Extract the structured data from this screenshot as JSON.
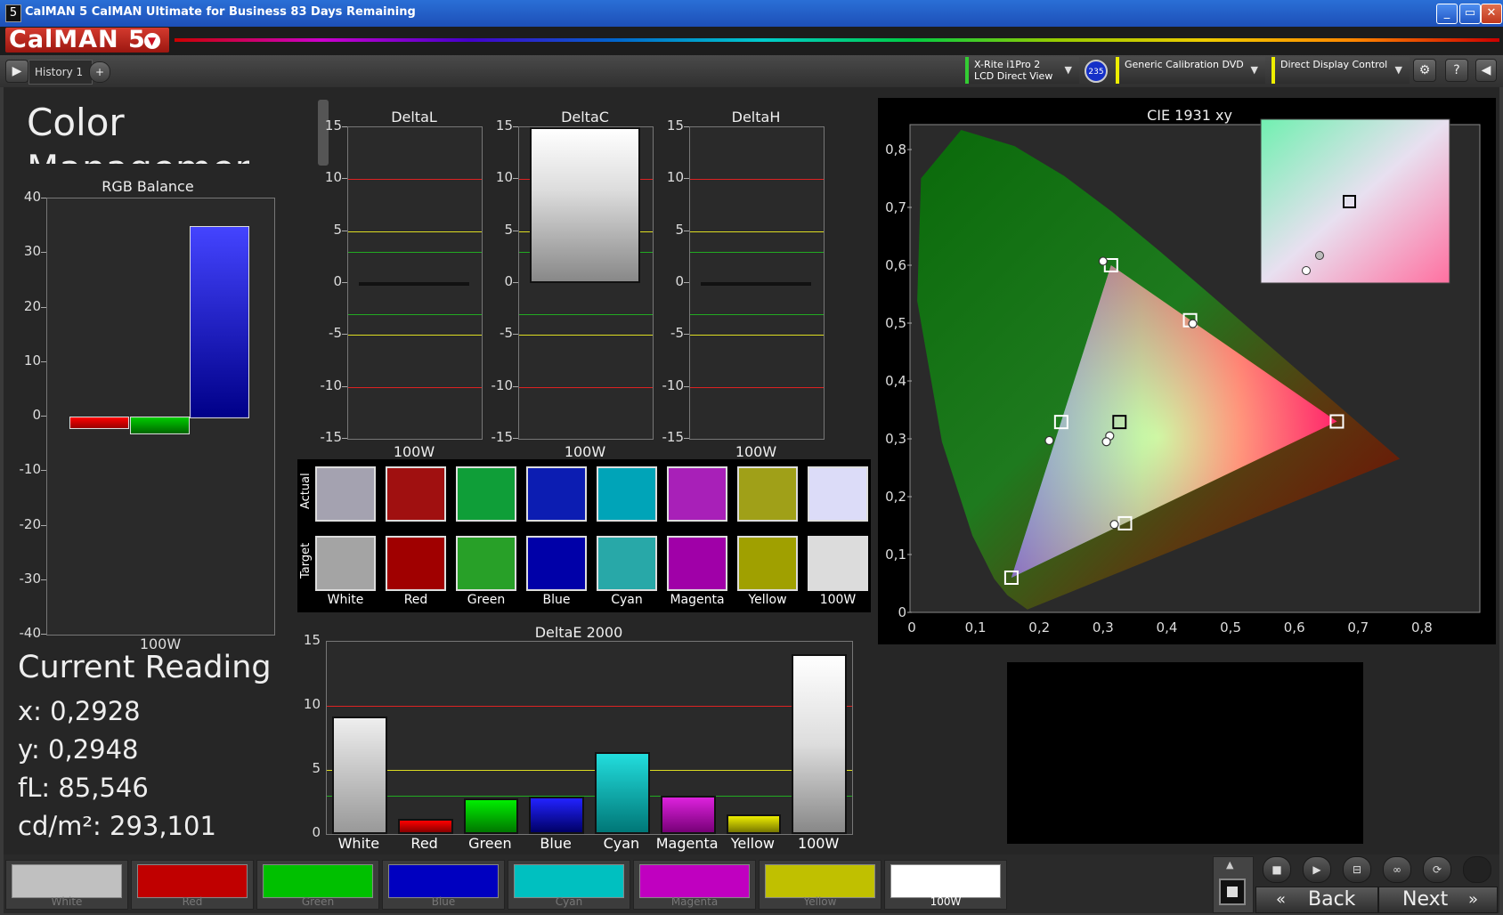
{
  "window": {
    "title": "CalMAN 5 CalMAN Ultimate for Business 83 Days Remaining",
    "min": "_",
    "max": "▭",
    "close": "✕"
  },
  "logo": {
    "text": "CalMAN 5"
  },
  "toolbar": {
    "play": "▶",
    "history_tab": "History 1",
    "add_tab": "+",
    "meter": {
      "line1": "X-Rite i1Pro 2",
      "line2": "LCD Direct View",
      "badge": "235"
    },
    "source": "Generic Calibration DVD",
    "display": "Direct Display Control",
    "settings": "⚙",
    "help": "?",
    "collapse": "◀",
    "dropdown": "▼"
  },
  "page": {
    "title": "Color Management"
  },
  "rgb_balance": {
    "title": "RGB Balance",
    "ticks": [
      "40",
      "30",
      "20",
      "10",
      "0",
      "-10",
      "-20",
      "-30",
      "-40"
    ],
    "xlabel": "100W"
  },
  "delta_charts": [
    {
      "title": "DeltaL",
      "xlabel": "100W"
    },
    {
      "title": "DeltaC",
      "xlabel": "100W"
    },
    {
      "title": "DeltaH",
      "xlabel": "100W"
    }
  ],
  "delta_ticks": [
    "15",
    "10",
    "5",
    "0",
    "-5",
    "-10",
    "-15"
  ],
  "swatches": {
    "actual_label": "Actual",
    "target_label": "Target",
    "names": [
      "White",
      "Red",
      "Green",
      "Blue",
      "Cyan",
      "Magenta",
      "Yellow",
      "100W"
    ],
    "actual_colors": [
      "#a4a2b0",
      "#a01010",
      "#0f9e38",
      "#0c1db2",
      "#00a4b8",
      "#a820b8",
      "#a0a018",
      "#dcdcf8"
    ],
    "target_colors": [
      "#a4a4a4",
      "#a00000",
      "#28a028",
      "#0000a8",
      "#28a8a8",
      "#a000a8",
      "#a0a000",
      "#dcdcdc"
    ]
  },
  "deltae": {
    "title": "DeltaE 2000",
    "ticks": [
      "15",
      "10",
      "5",
      "0"
    ]
  },
  "cie": {
    "title": "CIE 1931 xy",
    "yticks": [
      "0,8",
      "0,7",
      "0,6",
      "0,5",
      "0,4",
      "0,3",
      "0,2",
      "0,1",
      "0"
    ],
    "xticks": [
      "0",
      "0,1",
      "0,2",
      "0,3",
      "0,4",
      "0,5",
      "0,6",
      "0,7",
      "0,8"
    ]
  },
  "current_reading": {
    "title": "Current Reading",
    "x": "x: 0,2928",
    "y": "y: 0,2948",
    "fl": "fL: 85,546",
    "cdm2": "cd/m²: 293,101"
  },
  "bottom_swatches": [
    {
      "name": "White",
      "color": "#c0c0c0"
    },
    {
      "name": "Red",
      "color": "#c00000"
    },
    {
      "name": "Green",
      "color": "#00c000"
    },
    {
      "name": "Blue",
      "color": "#0000c0"
    },
    {
      "name": "Cyan",
      "color": "#00c0c0"
    },
    {
      "name": "Magenta",
      "color": "#c000c0"
    },
    {
      "name": "Yellow",
      "color": "#c0c000"
    },
    {
      "name": "100W",
      "color": "#ffffff"
    }
  ],
  "nav": {
    "back": "Back",
    "next": "Next",
    "back_icon": "«",
    "next_icon": "»"
  },
  "chart_data": [
    {
      "type": "bar",
      "title": "RGB Balance",
      "categories": [
        "100W"
      ],
      "ylim": [
        -40,
        40
      ],
      "series": [
        {
          "values": [
            -2
          ]
        },
        {
          "values": [
            -3
          ]
        },
        {
          "values": [
            35
          ]
        }
      ]
    },
    {
      "type": "bar",
      "title": "DeltaL",
      "categories": [
        "100W"
      ],
      "values": [
        0
      ],
      "ylim": [
        -15,
        15
      ]
    },
    {
      "type": "bar",
      "title": "DeltaC",
      "categories": [
        "100W"
      ],
      "values": [
        15
      ],
      "ylim": [
        -15,
        15
      ]
    },
    {
      "type": "bar",
      "title": "DeltaH",
      "categories": [
        "100W"
      ],
      "values": [
        0
      ],
      "ylim": [
        -15,
        15
      ]
    },
    {
      "type": "bar",
      "title": "DeltaE 2000",
      "categories": [
        "White",
        "Red",
        "Green",
        "Blue",
        "Cyan",
        "Magenta",
        "Yellow",
        "100W"
      ],
      "values": [
        9.2,
        1.2,
        2.8,
        2.9,
        6.4,
        3.0,
        1.5,
        14.0
      ],
      "ylim": [
        0,
        15
      ]
    },
    {
      "type": "scatter",
      "title": "CIE 1931 xy",
      "xlim": [
        0,
        0.8
      ],
      "ylim": [
        0,
        0.85
      ],
      "targets": [
        {
          "x": 0.64,
          "y": 0.33
        },
        {
          "x": 0.3,
          "y": 0.6
        },
        {
          "x": 0.15,
          "y": 0.06
        },
        {
          "x": 0.225,
          "y": 0.329
        },
        {
          "x": 0.321,
          "y": 0.154
        },
        {
          "x": 0.419,
          "y": 0.505
        },
        {
          "x": 0.3127,
          "y": 0.329
        }
      ],
      "measured": [
        {
          "x": 0.288,
          "y": 0.607
        },
        {
          "x": 0.423,
          "y": 0.499
        },
        {
          "x": 0.207,
          "y": 0.297
        },
        {
          "x": 0.305,
          "y": 0.152
        },
        {
          "x": 0.298,
          "y": 0.305
        },
        {
          "x": 0.293,
          "y": 0.295
        }
      ]
    }
  ]
}
